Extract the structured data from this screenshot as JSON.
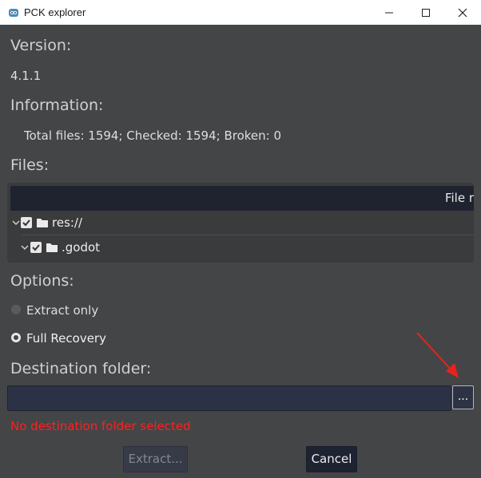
{
  "window": {
    "title": "PCK explorer",
    "icon": "godot-app-icon"
  },
  "version": {
    "heading": "Version:",
    "value": "4.1.1"
  },
  "information": {
    "heading": "Information:",
    "text": "Total files: 1594; Checked: 1594; Broken: 0"
  },
  "files": {
    "heading": "Files:",
    "column_header": "File r",
    "tree": [
      {
        "label": "res://",
        "checked": true,
        "expanded": true
      },
      {
        "label": ".godot",
        "checked": true,
        "expanded": true
      }
    ]
  },
  "options": {
    "heading": "Options:",
    "choices": [
      {
        "label": "Extract only",
        "selected": false
      },
      {
        "label": "Full Recovery",
        "selected": true
      }
    ]
  },
  "destination": {
    "heading": "Destination folder:",
    "value": "",
    "browse_label": "...",
    "error": "No destination folder selected"
  },
  "buttons": {
    "extract": "Extract...",
    "cancel": "Cancel"
  },
  "colors": {
    "error": "#ff2020",
    "annotation_arrow": "#e8231f",
    "background": "#444546"
  }
}
